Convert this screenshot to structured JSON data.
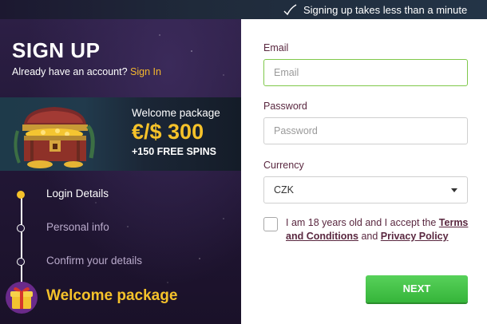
{
  "top_hint": {
    "text": "Signing up takes less than a minute",
    "icon": "check-swoosh-icon"
  },
  "left": {
    "title": "SIGN UP",
    "account_prompt": "Already have an account?",
    "sign_in_link": "Sign In",
    "promo": {
      "label": "Welcome package",
      "amount": "€/$ 300",
      "spins": "+150 FREE SPINS",
      "image": "treasure-chest"
    },
    "steps": [
      {
        "label": "Login Details",
        "active": true
      },
      {
        "label": "Personal info",
        "active": false
      },
      {
        "label": "Confirm your details",
        "active": false
      }
    ],
    "final_step": {
      "label": "Welcome package",
      "icon": "gift-icon"
    }
  },
  "form": {
    "email": {
      "label": "Email",
      "placeholder": "Email",
      "value": ""
    },
    "password": {
      "label": "Password",
      "placeholder": "Password",
      "value": ""
    },
    "currency": {
      "label": "Currency",
      "selected": "CZK"
    },
    "terms": {
      "prefix": "I am 18 years old and I accept the",
      "terms_link": "Terms and Conditions",
      "conjunction": "and",
      "privacy_link": "Privacy Policy",
      "checked": false
    },
    "next_button": "NEXT"
  },
  "colors": {
    "accent_gold": "#f5c22a",
    "cta_green": "#3fbf43",
    "label_text": "#5a2840",
    "panel_purple": "#24193a"
  }
}
